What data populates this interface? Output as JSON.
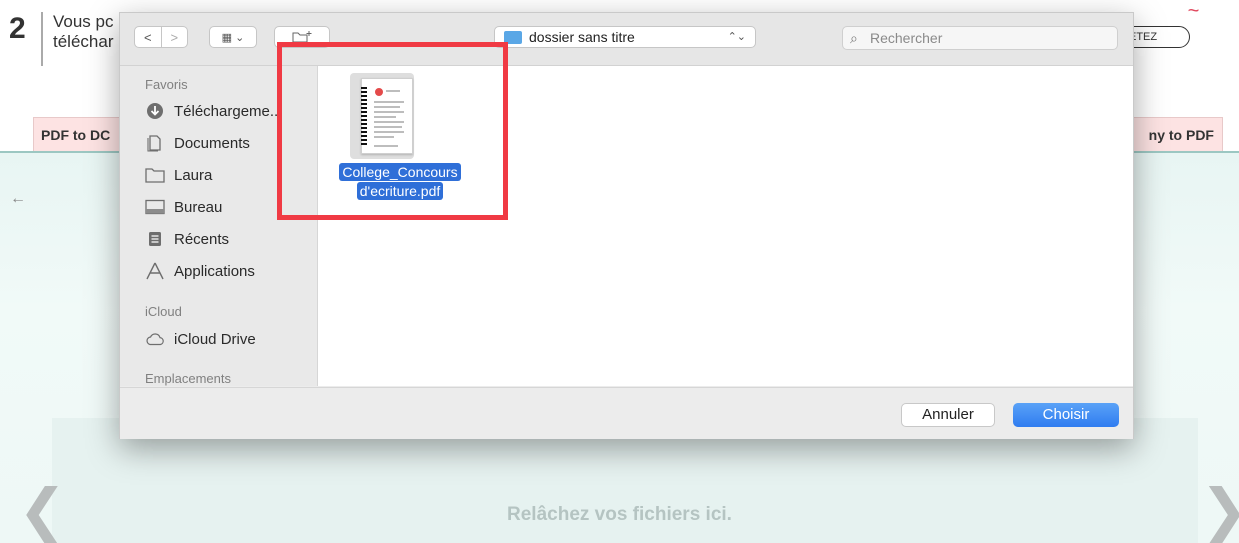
{
  "background_page": {
    "step_number": "2",
    "step_text_line1": "Vous pc",
    "step_text_line2": "téléchar",
    "brand_fragment": "~",
    "oval_button": "ETEZ",
    "tab_left": "PDF to DC",
    "tab_right": "ny to PDF",
    "back_arrow": "←",
    "drop_text": "Relâchez vos fichiers ici.",
    "chevron_left": "❮",
    "chevron_right": "❯"
  },
  "dialog": {
    "toolbar": {
      "back_glyph": "<",
      "forward_glyph": ">",
      "view_glyph": "▦ ⌄",
      "new_folder_glyph": "⊏+",
      "path_popup": "dossier sans titre",
      "path_popup_arrow": "⌃⌄",
      "search_placeholder": "Rechercher"
    },
    "sidebar": {
      "favorites_header": "Favoris",
      "items": [
        {
          "label": "Téléchargeme...",
          "icon": "download-icon"
        },
        {
          "label": "Documents",
          "icon": "documents-icon"
        },
        {
          "label": "Laura",
          "icon": "folder-icon"
        },
        {
          "label": "Bureau",
          "icon": "desktop-icon"
        },
        {
          "label": "Récents",
          "icon": "recents-icon"
        },
        {
          "label": "Applications",
          "icon": "applications-icon"
        }
      ],
      "icloud_header": "iCloud",
      "icloud_items": [
        {
          "label": "iCloud Drive",
          "icon": "cloud-icon"
        }
      ],
      "locations_header": "Emplacements"
    },
    "content": {
      "file_name_line1": "College_Concours",
      "file_name_line2": "d'ecriture.pdf"
    },
    "buttons": {
      "cancel": "Annuler",
      "choose": "Choisir"
    }
  },
  "colors": {
    "highlight": "#f03a44",
    "accent_blue": "#2f7cf0",
    "tab_bg": "#fde3e3"
  }
}
